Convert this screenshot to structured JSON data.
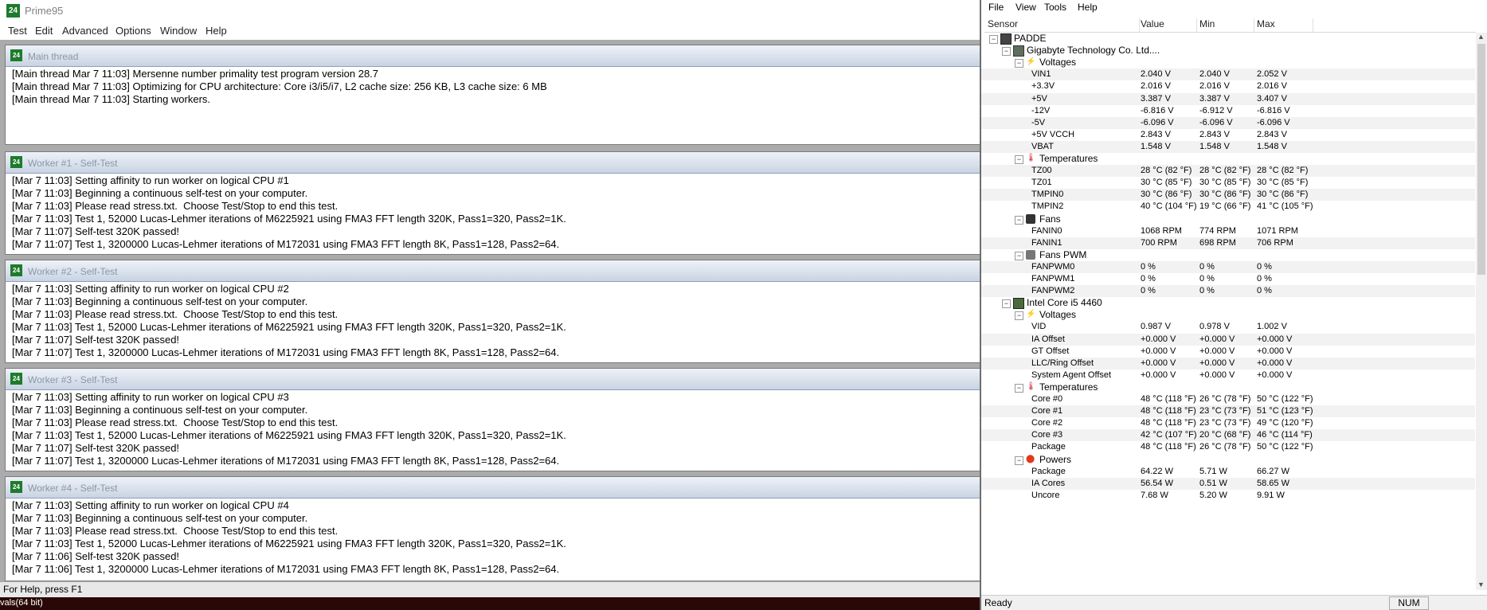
{
  "prime95": {
    "title": "Prime95",
    "menu": [
      "Test",
      "Edit",
      "Advanced",
      "Options",
      "Window",
      "Help"
    ],
    "panels": [
      {
        "title": "Main thread",
        "lines": [
          "[Main thread Mar 7 11:03] Mersenne number primality test program version 28.7",
          "[Main thread Mar 7 11:03] Optimizing for CPU architecture: Core i3/i5/i7, L2 cache size: 256 KB, L3 cache size: 6 MB",
          "[Main thread Mar 7 11:03] Starting workers."
        ]
      },
      {
        "title": "Worker #1 - Self-Test",
        "lines": [
          "[Mar 7 11:03] Setting affinity to run worker on logical CPU #1",
          "[Mar 7 11:03] Beginning a continuous self-test on your computer.",
          "[Mar 7 11:03] Please read stress.txt.  Choose Test/Stop to end this test.",
          "[Mar 7 11:03] Test 1, 52000 Lucas-Lehmer iterations of M6225921 using FMA3 FFT length 320K, Pass1=320, Pass2=1K.",
          "[Mar 7 11:07] Self-test 320K passed!",
          "[Mar 7 11:07] Test 1, 3200000 Lucas-Lehmer iterations of M172031 using FMA3 FFT length 8K, Pass1=128, Pass2=64."
        ]
      },
      {
        "title": "Worker #2 - Self-Test",
        "lines": [
          "[Mar 7 11:03] Setting affinity to run worker on logical CPU #2",
          "[Mar 7 11:03] Beginning a continuous self-test on your computer.",
          "[Mar 7 11:03] Please read stress.txt.  Choose Test/Stop to end this test.",
          "[Mar 7 11:03] Test 1, 52000 Lucas-Lehmer iterations of M6225921 using FMA3 FFT length 320K, Pass1=320, Pass2=1K.",
          "[Mar 7 11:07] Self-test 320K passed!",
          "[Mar 7 11:07] Test 1, 3200000 Lucas-Lehmer iterations of M172031 using FMA3 FFT length 8K, Pass1=128, Pass2=64."
        ]
      },
      {
        "title": "Worker #3 - Self-Test",
        "lines": [
          "[Mar 7 11:03] Setting affinity to run worker on logical CPU #3",
          "[Mar 7 11:03] Beginning a continuous self-test on your computer.",
          "[Mar 7 11:03] Please read stress.txt.  Choose Test/Stop to end this test.",
          "[Mar 7 11:03] Test 1, 52000 Lucas-Lehmer iterations of M6225921 using FMA3 FFT length 320K, Pass1=320, Pass2=1K.",
          "[Mar 7 11:07] Self-test 320K passed!",
          "[Mar 7 11:07] Test 1, 3200000 Lucas-Lehmer iterations of M172031 using FMA3 FFT length 8K, Pass1=128, Pass2=64."
        ]
      },
      {
        "title": "Worker #4 - Self-Test",
        "lines": [
          "[Mar 7 11:03] Setting affinity to run worker on logical CPU #4",
          "[Mar 7 11:03] Beginning a continuous self-test on your computer.",
          "[Mar 7 11:03] Please read stress.txt.  Choose Test/Stop to end this test.",
          "[Mar 7 11:03] Test 1, 52000 Lucas-Lehmer iterations of M6225921 using FMA3 FFT length 320K, Pass1=320, Pass2=1K.",
          "[Mar 7 11:06] Self-test 320K passed!",
          "[Mar 7 11:06] Test 1, 3200000 Lucas-Lehmer iterations of M172031 using FMA3 FFT length 8K, Pass1=128, Pass2=64."
        ]
      }
    ],
    "status": "For Help, press F1",
    "background_strip": "vals(64 bit)"
  },
  "hwmonitor": {
    "menu": [
      "File",
      "View",
      "Tools",
      "Help"
    ],
    "columns": [
      "Sensor",
      "Value",
      "Min",
      "Max"
    ],
    "tree": [
      {
        "level": 0,
        "kind": "node",
        "icon": "pc-icon",
        "label": "PADDE"
      },
      {
        "level": 1,
        "kind": "node",
        "icon": "motherboard-icon",
        "label": "Gigabyte Technology Co. Ltd...."
      },
      {
        "level": 2,
        "kind": "group",
        "icon": "voltage-icon",
        "label": "Voltages"
      },
      {
        "level": 3,
        "kind": "sensor",
        "label": "VIN1",
        "value": "2.040 V",
        "min": "2.040 V",
        "max": "2.052 V"
      },
      {
        "level": 3,
        "kind": "sensor",
        "label": "+3.3V",
        "value": "2.016 V",
        "min": "2.016 V",
        "max": "2.016 V"
      },
      {
        "level": 3,
        "kind": "sensor",
        "label": "+5V",
        "value": "3.387 V",
        "min": "3.387 V",
        "max": "3.407 V"
      },
      {
        "level": 3,
        "kind": "sensor",
        "label": "-12V",
        "value": "-6.816 V",
        "min": "-6.912 V",
        "max": "-6.816 V"
      },
      {
        "level": 3,
        "kind": "sensor",
        "label": "-5V",
        "value": "-6.096 V",
        "min": "-6.096 V",
        "max": "-6.096 V"
      },
      {
        "level": 3,
        "kind": "sensor",
        "label": "+5V VCCH",
        "value": "2.843 V",
        "min": "2.843 V",
        "max": "2.843 V"
      },
      {
        "level": 3,
        "kind": "sensor",
        "label": "VBAT",
        "value": "1.548 V",
        "min": "1.548 V",
        "max": "1.548 V"
      },
      {
        "level": 2,
        "kind": "group",
        "icon": "temperature-icon",
        "label": "Temperatures"
      },
      {
        "level": 3,
        "kind": "sensor",
        "label": "TZ00",
        "value": "28 °C  (82 °F)",
        "min": "28 °C  (82 °F)",
        "max": "28 °C  (82 °F)"
      },
      {
        "level": 3,
        "kind": "sensor",
        "label": "TZ01",
        "value": "30 °C  (85 °F)",
        "min": "30 °C  (85 °F)",
        "max": "30 °C  (85 °F)"
      },
      {
        "level": 3,
        "kind": "sensor",
        "label": "TMPIN0",
        "value": "30 °C  (86 °F)",
        "min": "30 °C  (86 °F)",
        "max": "30 °C  (86 °F)"
      },
      {
        "level": 3,
        "kind": "sensor",
        "label": "TMPIN2",
        "value": "40 °C  (104 °F)",
        "min": "19 °C  (66 °F)",
        "max": "41 °C  (105 °F)"
      },
      {
        "level": 2,
        "kind": "group",
        "icon": "fan-icon",
        "label": "Fans"
      },
      {
        "level": 3,
        "kind": "sensor",
        "label": "FANIN0",
        "value": "1068 RPM",
        "min": "774 RPM",
        "max": "1071 RPM"
      },
      {
        "level": 3,
        "kind": "sensor",
        "label": "FANIN1",
        "value": "700 RPM",
        "min": "698 RPM",
        "max": "706 RPM"
      },
      {
        "level": 2,
        "kind": "group",
        "icon": "fan-pwm-icon",
        "label": "Fans PWM"
      },
      {
        "level": 3,
        "kind": "sensor",
        "label": "FANPWM0",
        "value": "0 %",
        "min": "0 %",
        "max": "0 %"
      },
      {
        "level": 3,
        "kind": "sensor",
        "label": "FANPWM1",
        "value": "0 %",
        "min": "0 %",
        "max": "0 %"
      },
      {
        "level": 3,
        "kind": "sensor",
        "label": "FANPWM2",
        "value": "0 %",
        "min": "0 %",
        "max": "0 %"
      },
      {
        "level": 1,
        "kind": "node",
        "icon": "cpu-icon",
        "label": "Intel Core i5 4460"
      },
      {
        "level": 2,
        "kind": "group",
        "icon": "voltage-icon",
        "label": "Voltages"
      },
      {
        "level": 3,
        "kind": "sensor",
        "label": "VID",
        "value": "0.987 V",
        "min": "0.978 V",
        "max": "1.002 V"
      },
      {
        "level": 3,
        "kind": "sensor",
        "label": "IA Offset",
        "value": "+0.000 V",
        "min": "+0.000 V",
        "max": "+0.000 V"
      },
      {
        "level": 3,
        "kind": "sensor",
        "label": "GT Offset",
        "value": "+0.000 V",
        "min": "+0.000 V",
        "max": "+0.000 V"
      },
      {
        "level": 3,
        "kind": "sensor",
        "label": "LLC/Ring Offset",
        "value": "+0.000 V",
        "min": "+0.000 V",
        "max": "+0.000 V"
      },
      {
        "level": 3,
        "kind": "sensor",
        "label": "System Agent Offset",
        "value": "+0.000 V",
        "min": "+0.000 V",
        "max": "+0.000 V"
      },
      {
        "level": 2,
        "kind": "group",
        "icon": "temperature-icon",
        "label": "Temperatures"
      },
      {
        "level": 3,
        "kind": "sensor",
        "label": "Core #0",
        "value": "48 °C  (118 °F)",
        "min": "26 °C  (78 °F)",
        "max": "50 °C  (122 °F)"
      },
      {
        "level": 3,
        "kind": "sensor",
        "label": "Core #1",
        "value": "48 °C  (118 °F)",
        "min": "23 °C  (73 °F)",
        "max": "51 °C  (123 °F)"
      },
      {
        "level": 3,
        "kind": "sensor",
        "label": "Core #2",
        "value": "48 °C  (118 °F)",
        "min": "23 °C  (73 °F)",
        "max": "49 °C  (120 °F)"
      },
      {
        "level": 3,
        "kind": "sensor",
        "label": "Core #3",
        "value": "42 °C  (107 °F)",
        "min": "20 °C  (68 °F)",
        "max": "46 °C  (114 °F)"
      },
      {
        "level": 3,
        "kind": "sensor",
        "label": "Package",
        "value": "48 °C  (118 °F)",
        "min": "26 °C  (78 °F)",
        "max": "50 °C  (122 °F)"
      },
      {
        "level": 2,
        "kind": "group",
        "icon": "power-icon",
        "label": "Powers"
      },
      {
        "level": 3,
        "kind": "sensor",
        "label": "Package",
        "value": "64.22 W",
        "min": "5.71 W",
        "max": "66.27 W"
      },
      {
        "level": 3,
        "kind": "sensor",
        "label": "IA Cores",
        "value": "56.54 W",
        "min": "0.51 W",
        "max": "58.65 W"
      },
      {
        "level": 3,
        "kind": "sensor",
        "label": "Uncore",
        "value": "7.68 W",
        "min": "5.20 W",
        "max": "9.91 W"
      }
    ],
    "status": "Ready",
    "num_indicator": "NUM"
  }
}
